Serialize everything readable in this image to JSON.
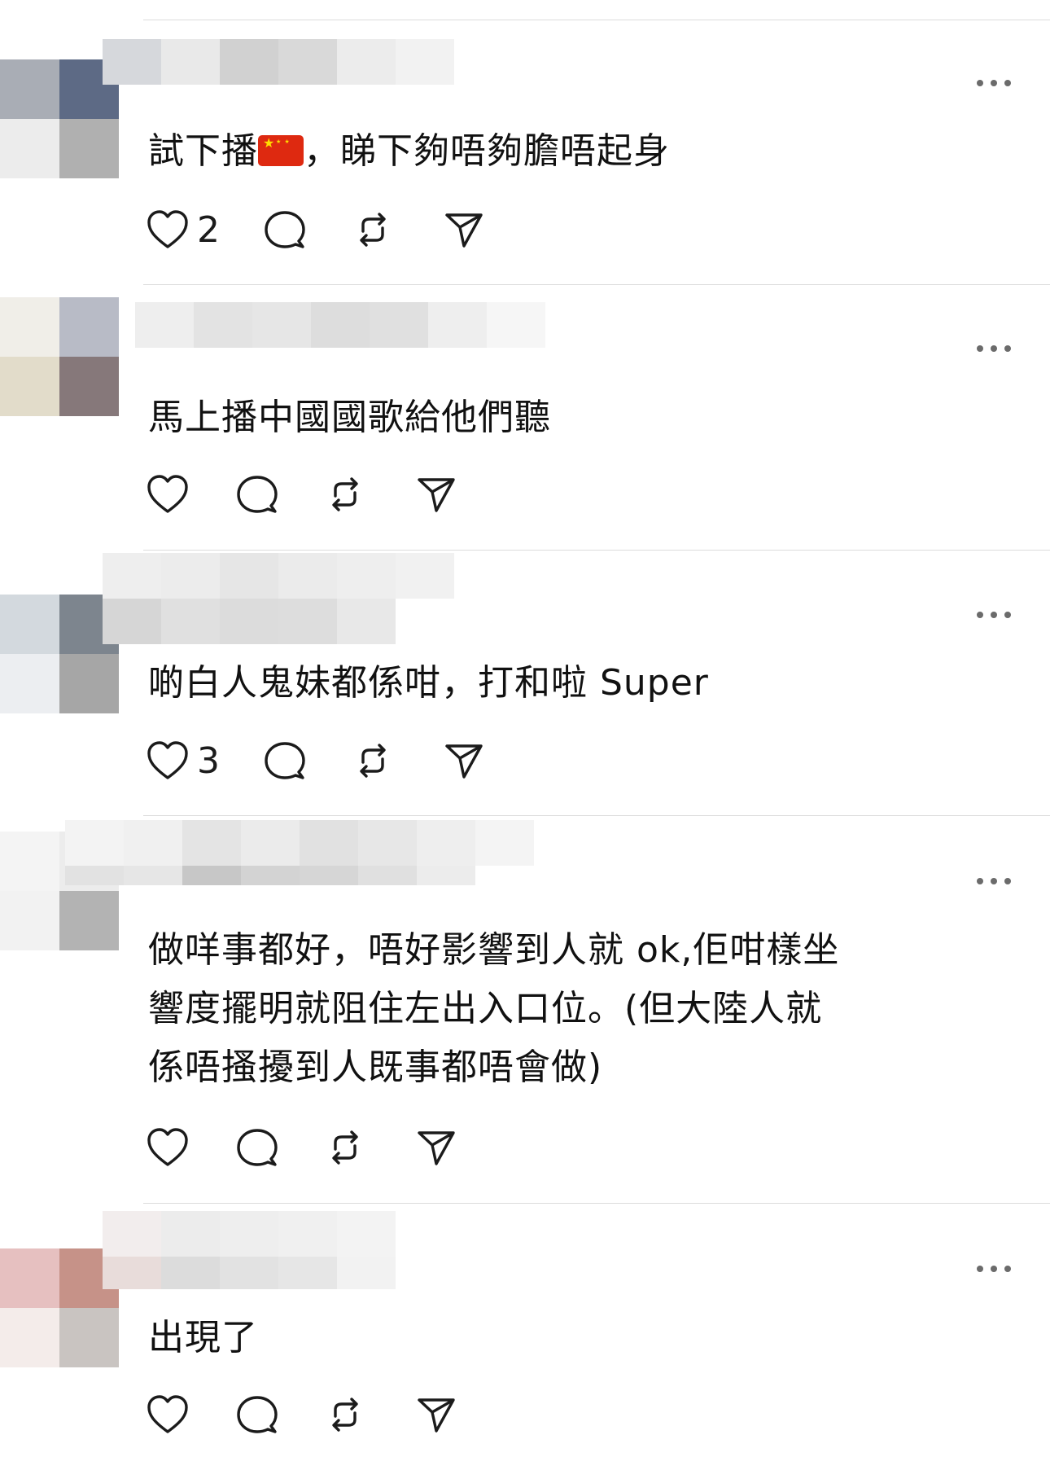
{
  "threads": [
    {
      "body_html": "試下播{flag}，睇下夠唔夠膽唔起身",
      "text_pre": "試下播",
      "flag_icon": "china-flag-emoji",
      "text_post": "，睇下夠唔夠膽唔起身",
      "likes": "2"
    },
    {
      "text": "馬上播中國國歌給他們聽",
      "likes": ""
    },
    {
      "text": "啲白人鬼妹都係咁，打和啦 Super",
      "likes": "3"
    },
    {
      "text": "做咩事都好，唔好影響到人就 ok,佢咁樣坐\n響度擺明就阻住左出入口位。(但大陸人就\n係唔搔擾到人既事都唔會做)",
      "likes": ""
    },
    {
      "text": "出現了",
      "likes": ""
    }
  ],
  "icons": {
    "like": "heart-icon",
    "reply": "comment-icon",
    "repost": "repost-icon",
    "share": "send-icon",
    "more": "more-dots-icon"
  },
  "colors": {
    "divider": "#dcdcdc",
    "icon": "#1b1b1b",
    "text": "#111111"
  }
}
